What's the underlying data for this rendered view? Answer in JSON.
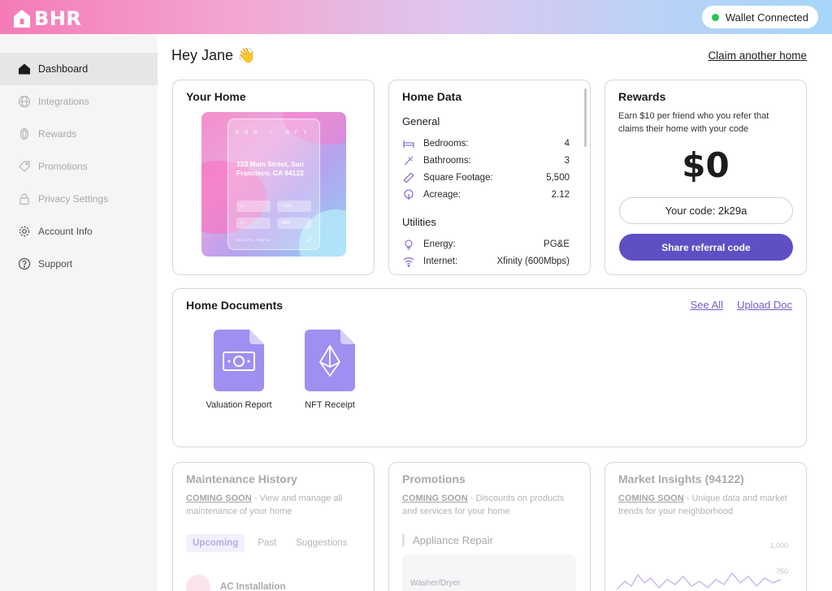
{
  "app": {
    "brand": "BHR",
    "wallet_status": "Wallet Connected",
    "colors": {
      "accent": "#5e4fc4",
      "link": "#6c5fd1",
      "online": "#23c552"
    }
  },
  "sidebar": {
    "items": [
      {
        "label": "Dashboard",
        "icon": "house-icon",
        "active": true
      },
      {
        "label": "Integrations",
        "icon": "globe-icon",
        "active": false
      },
      {
        "label": "Rewards",
        "icon": "coin-icon",
        "active": false
      },
      {
        "label": "Promotions",
        "icon": "tag-icon",
        "active": false
      },
      {
        "label": "Privacy Settings",
        "icon": "lock-icon",
        "active": false
      },
      {
        "label": "Account Info",
        "icon": "gear-icon",
        "active": false
      },
      {
        "label": "Support",
        "icon": "help-icon",
        "active": false
      }
    ]
  },
  "main": {
    "greeting": "Hey Jane",
    "greeting_emoji": "👋",
    "claim_link": "Claim another home"
  },
  "your_home": {
    "title": "Your Home",
    "nft": {
      "header": "BHR ⌂ NFT",
      "address": "123 Main Street, San Francisco, CA 94122",
      "tiles": [
        "3",
        "2,500",
        "2",
        "1950"
      ],
      "footer": "ELADITO, POWNA"
    }
  },
  "home_data": {
    "title": "Home Data",
    "general_title": "General",
    "general": [
      {
        "label": "Bedrooms:",
        "value": "4",
        "icon": "bed-icon"
      },
      {
        "label": "Bathrooms:",
        "value": "3",
        "icon": "shower-icon"
      },
      {
        "label": "Square Footage:",
        "value": "5,500",
        "icon": "ruler-icon"
      },
      {
        "label": "Acreage:",
        "value": "2.12",
        "icon": "tree-icon"
      }
    ],
    "utilities_title": "Utilities",
    "utilities": [
      {
        "label": "Energy:",
        "value": "PG&E",
        "icon": "bulb-icon"
      },
      {
        "label": "Internet:",
        "value": "Xfinity (600Mbps)",
        "icon": "wifi-icon"
      }
    ]
  },
  "rewards": {
    "title": "Rewards",
    "description": "Earn $10 per friend who you refer that claims their home with your code",
    "amount": "$0",
    "code_label": "Your code: 2k29a",
    "share_button": "Share referral code"
  },
  "documents": {
    "title": "Home Documents",
    "see_all": "See All",
    "upload": "Upload Doc",
    "items": [
      {
        "label": "Valuation Report",
        "icon": "money-icon"
      },
      {
        "label": "NFT Receipt",
        "icon": "ethereum-icon"
      }
    ]
  },
  "maintenance": {
    "title": "Maintenance History",
    "soon": "COMING SOON",
    "text": " - View and manage all maintenance of your home",
    "tabs": [
      "Upcoming",
      "Past",
      "Suggestions"
    ],
    "item": "AC Installation"
  },
  "promotions": {
    "title": "Promotions",
    "soon": "COMING SOON",
    "text": " - Discounts on products and services for your home",
    "category": "Appliance Repair",
    "item_label": "Washer/Dryer"
  },
  "market": {
    "title": "Market Insights (94122)",
    "soon": "COMING SOON",
    "text": " - Unique data and market trends for your neighborhood",
    "ticks": [
      "1,000",
      "750"
    ]
  }
}
